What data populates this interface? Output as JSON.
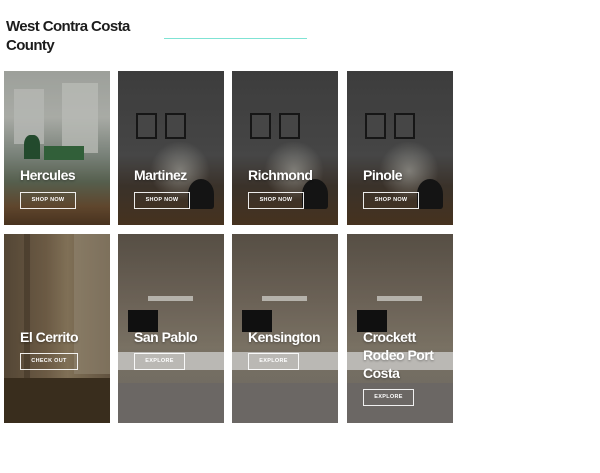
{
  "page": {
    "title": "West Contra Costa County"
  },
  "cards": [
    {
      "name": "Hercules",
      "button": "SHOP NOW",
      "scene": "living-room-green"
    },
    {
      "name": "Martinez",
      "button": "SHOP NOW",
      "scene": "frames-chair"
    },
    {
      "name": "Richmond",
      "button": "SHOP NOW",
      "scene": "frames-chair"
    },
    {
      "name": "Pinole",
      "button": "SHOP NOW",
      "scene": "frames-chair"
    },
    {
      "name": "El Cerrito",
      "button": "CHECK OUT",
      "scene": "wood-kitchen"
    },
    {
      "name": "San Pablo",
      "button": "EXPLORE",
      "scene": "tv-wall"
    },
    {
      "name": "Kensington",
      "button": "EXPLORE",
      "scene": "tv-wall"
    },
    {
      "name": "Crockett Rodeo Port Costa",
      "button": "EXPLORE",
      "scene": "tv-wall"
    }
  ],
  "colors": {
    "accent_line": "#7fe3d4",
    "page_bg": "#ffffff"
  }
}
